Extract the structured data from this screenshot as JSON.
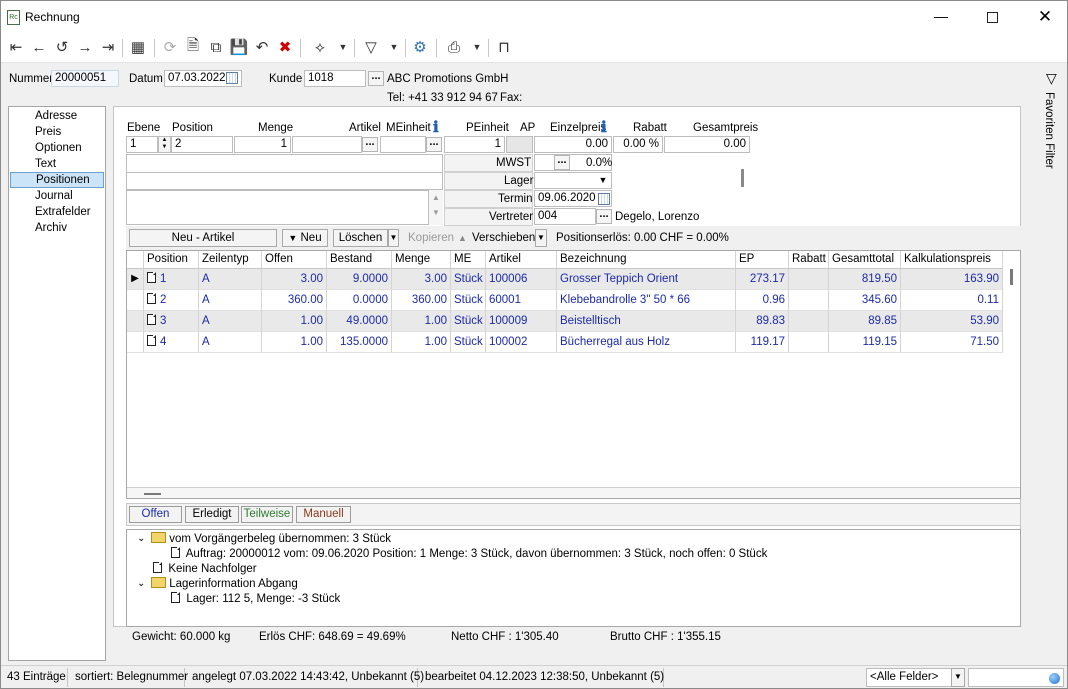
{
  "window": {
    "title": "Rechnung",
    "app_icon_text": "Rc"
  },
  "header": {
    "nummer_label": "Nummer",
    "nummer_value": "20000051",
    "datum_label": "Datum",
    "datum_value": "07.03.2022",
    "kunde_label": "Kunde",
    "kunde_value": "1018",
    "kunde_name": "ABC Promotions GmbH",
    "tel": "Tel: +41 33 912 94 67",
    "fax": "Fax:"
  },
  "right_sidebar": {
    "label": "Favoriten Filter"
  },
  "nav": {
    "items": [
      "Adresse",
      "Preis",
      "Optionen",
      "Text",
      "Positionen",
      "Journal",
      "Extrafelder",
      "Archiv"
    ],
    "selected": "Positionen"
  },
  "entry": {
    "ebene_label": "Ebene",
    "ebene_value": "1",
    "position_label": "Position",
    "position_value": "2",
    "menge_label": "Menge",
    "menge_value": "1",
    "artikel_label": "Artikel",
    "artikel_value": "",
    "meinheit_label": "MEinheit",
    "peinheit_label": "PEinheit",
    "peinheit_value": "1",
    "ap_label": "AP",
    "einzelpreis_label": "Einzelpreis",
    "einzelpreis_value": "0.00",
    "rabatt_label": "Rabatt",
    "rabatt_value": "0.00 %",
    "gesamtpreis_label": "Gesamtpreis",
    "gesamtpreis_value": "0.00",
    "mwst_label": "MWST",
    "mwst_value": "0.0%",
    "lager_label": "Lager",
    "lager_value": "",
    "termin_label": "Termin",
    "termin_value": "09.06.2020",
    "vertreter_label": "Vertreter",
    "vertreter_value": "004",
    "vertreter_name": "Degelo, Lorenzo"
  },
  "actions": {
    "neu_artikel": "Neu - Artikel",
    "neu": "Neu",
    "loeschen": "Löschen",
    "kopieren": "Kopieren",
    "verschieben": "Verschieben",
    "positionserloes": "Positionserlös:  0.00 CHF = 0.00%"
  },
  "grid": {
    "columns": [
      "Position",
      "Zeilentyp",
      "Offen",
      "Bestand",
      "Menge",
      "ME",
      "Artikel",
      "Bezeichnung",
      "EP",
      "Rabatt",
      "Gesamttotal",
      "Kalkulationspreis"
    ],
    "rows": [
      {
        "position": "1",
        "zeilentyp": "A",
        "offen": "3.00",
        "bestand": "9.0000",
        "menge": "3.00",
        "me": "Stück",
        "artikel": "100006",
        "bezeichnung": "Grosser Teppich Orient",
        "ep": "273.17",
        "rabatt": "",
        "gesamttotal": "819.50",
        "kalkulationspreis": "163.90"
      },
      {
        "position": "2",
        "zeilentyp": "A",
        "offen": "360.00",
        "bestand": "0.0000",
        "menge": "360.00",
        "me": "Stück",
        "artikel": "60001",
        "bezeichnung": "Klebebandrolle 3\" 50 * 66",
        "ep": "0.96",
        "rabatt": "",
        "gesamttotal": "345.60",
        "kalkulationspreis": "0.11"
      },
      {
        "position": "3",
        "zeilentyp": "A",
        "offen": "1.00",
        "bestand": "49.0000",
        "menge": "1.00",
        "me": "Stück",
        "artikel": "100009",
        "bezeichnung": "Beistelltisch",
        "ep": "89.83",
        "rabatt": "",
        "gesamttotal": "89.85",
        "kalkulationspreis": "53.90"
      },
      {
        "position": "4",
        "zeilentyp": "A",
        "offen": "1.00",
        "bestand": "135.0000",
        "menge": "1.00",
        "me": "Stück",
        "artikel": "100002",
        "bezeichnung": "Bücherregal aus Holz",
        "ep": "119.17",
        "rabatt": "",
        "gesamttotal": "119.15",
        "kalkulationspreis": "71.50"
      }
    ]
  },
  "filters": {
    "offen": "Offen",
    "erledigt": "Erledigt",
    "teilweise": "Teilweise",
    "manuell": "Manuell"
  },
  "tree": {
    "node1": "vom Vorgängerbeleg übernommen: 3 Stück",
    "node1_child": "Auftrag: 20000012 vom: 09.06.2020 Position: 1 Menge: 3 Stück, davon übernommen: 3 Stück, noch offen: 0 Stück",
    "node2": "Keine Nachfolger",
    "node3": "Lagerinformation Abgang",
    "node3_child": "Lager: 112 5, Menge: -3 Stück"
  },
  "totals": {
    "gewicht": "Gewicht:  60.000 kg",
    "erloes": "Erlös CHF: 648.69 = 49.69%",
    "netto": "Netto CHF :  1'305.40",
    "brutto": "Brutto CHF :  1'355.15"
  },
  "statusbar": {
    "eintraege": "43 Einträge",
    "sortiert": "sortiert: Belegnummer",
    "angelegt": "angelegt 07.03.2022 14:43:42, Unbekannt (5)",
    "bearbeitet": "bearbeitet 04.12.2023 12:38:50, Unbekannt (5)",
    "felder": "<Alle Felder>"
  },
  "colors": {
    "accent": "#1c2aa8",
    "selection": "#cce4f7",
    "teilweise": "#2e7d2e",
    "manuell": "#8b3a1a"
  }
}
